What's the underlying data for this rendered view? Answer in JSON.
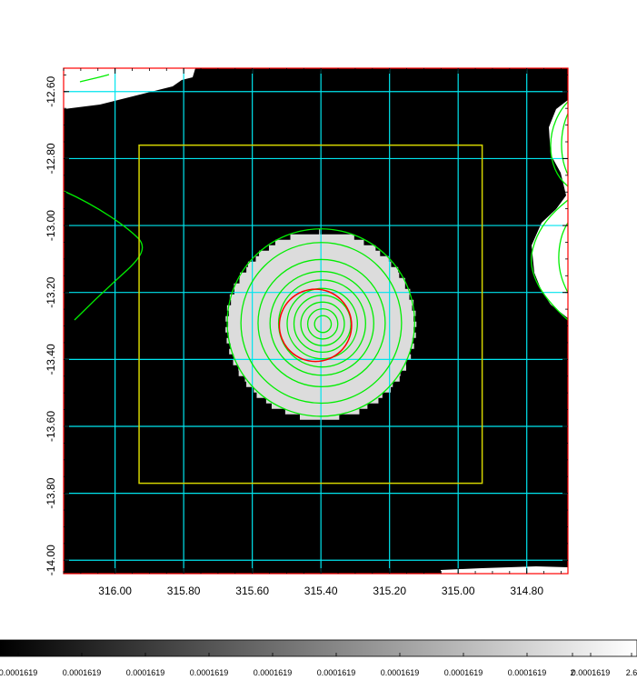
{
  "chart_data": {
    "type": "heatmap",
    "title": "",
    "xlabel": "",
    "ylabel": "",
    "x_axis": {
      "direction": "decreasing-to-right",
      "ticks": [
        316.0,
        315.8,
        315.6,
        315.4,
        315.2,
        315.0,
        314.8
      ],
      "tick_labels": [
        "316.00",
        "315.80",
        "315.60",
        "315.40",
        "315.20",
        "315.00",
        "314.80"
      ],
      "xlim": [
        316.15,
        314.68
      ]
    },
    "y_axis": {
      "ticks": [
        -12.6,
        -12.8,
        -13.0,
        -13.2,
        -13.4,
        -13.6,
        -13.8,
        -14.0
      ],
      "tick_labels": [
        "-12.60",
        "-12.80",
        "-13.00",
        "-13.20",
        "-13.40",
        "-13.60",
        "-13.80",
        "-14.00"
      ],
      "ylim": [
        -14.04,
        -12.53
      ]
    },
    "grid": true,
    "colors": {
      "background": "#000000",
      "grid": "#00e5ee",
      "frame": "#ff0000",
      "source_disk": "#dcdcdc",
      "contours": "#00ee00",
      "region_box": "#d4d400",
      "region_circle": "#ff0000"
    },
    "source": {
      "center": [
        315.4,
        -13.29
      ],
      "radius_deg": 0.28,
      "contour_radii_deg": [
        0.28,
        0.24,
        0.19,
        0.155,
        0.13,
        0.105,
        0.085,
        0.065,
        0.045,
        0.025
      ],
      "inner_circle_radius_deg": 0.085
    },
    "region_box": {
      "x": [
        315.93,
        314.93
      ],
      "y": [
        -12.76,
        -13.77
      ]
    },
    "colorbar": {
      "tick_labels": [
        "0.0001619",
        "0.0001619",
        "0.0001619",
        "0.0001619",
        "0.0001619",
        "0.0001619",
        "0.0001619",
        "0.0001619",
        "0.0001619",
        "0.0001619",
        "2",
        "2.6"
      ],
      "gradient": [
        "#000000",
        "#ffffff"
      ]
    }
  }
}
